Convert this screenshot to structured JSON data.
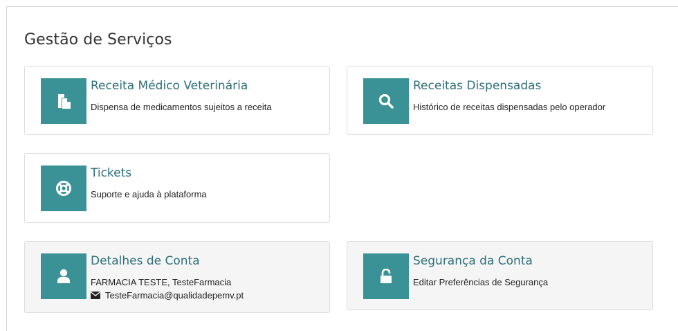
{
  "page": {
    "title": "Gestão de Serviços"
  },
  "colors": {
    "accent": "#3a9296",
    "title_text": "#2f6f79",
    "card_border": "#dcdcdc"
  },
  "cards": [
    {
      "title": "Receita Médico Veterinária",
      "description": "Dispensa de medicamentos sujeitos a receita",
      "icon": "document-copy-icon"
    },
    {
      "title": "Receitas Dispensadas",
      "description": "Histórico de receitas dispensadas pelo operador",
      "icon": "search-icon"
    },
    {
      "title": "Tickets",
      "description": "Suporte e ajuda à plataforma",
      "icon": "life-ring-icon"
    }
  ],
  "account": {
    "title": "Detalhes de Conta",
    "name": "FARMACIA TESTE, TesteFarmacia",
    "email": "TesteFarmacia@qualidadepemv.pt",
    "icon": "user-icon",
    "email_icon": "envelope-icon"
  },
  "security": {
    "title": "Segurança da Conta",
    "description": "Editar Preferências de Segurança",
    "icon": "unlock-icon"
  }
}
